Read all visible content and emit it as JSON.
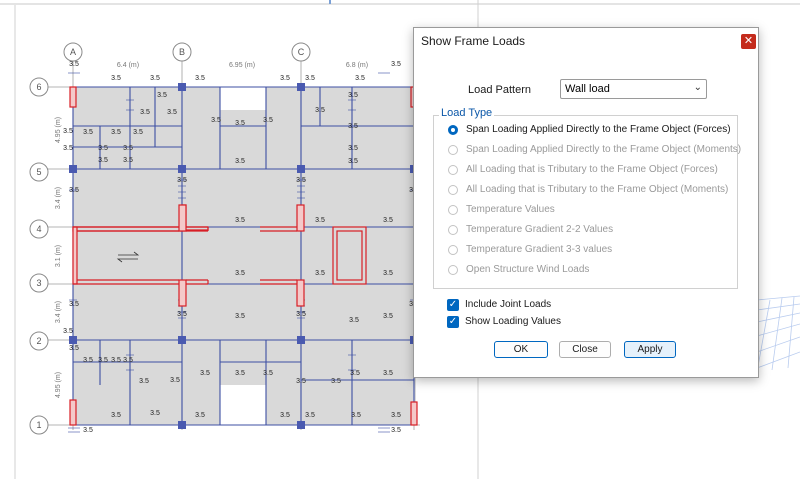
{
  "plan": {
    "grid_x_labels": [
      "A",
      "B",
      "C"
    ],
    "grid_y_labels": [
      "6",
      "5",
      "4",
      "3",
      "2",
      "1"
    ],
    "x_spacing_labels": [
      "6.4 (m)",
      "6.95 (m)",
      "6.8 (m)"
    ],
    "y_spacing_labels": [
      "4.95 (m)",
      "3.4 (m)",
      "3.1 (m)",
      "3.4 (m)",
      "4.95 (m)"
    ],
    "load_value": "3.5",
    "colors": {
      "slab": "#d9d9d9",
      "beam": "#3d4fa3",
      "wall": "#d81f26",
      "wall_fill": "#f4c9c9",
      "column": "#4a5ab0",
      "grid_line": "#9e9e9e"
    }
  },
  "dialog": {
    "title": "Show Frame Loads",
    "close_icon": "close-icon",
    "load_pattern_label": "Load Pattern",
    "load_pattern_value": "Wall load",
    "load_type_label": "Load Type",
    "load_type_options": [
      {
        "label": "Span Loading Applied Directly to the Frame Object (Forces)",
        "selected": true,
        "enabled": true
      },
      {
        "label": "Span Loading Applied Directly to the Frame Object (Moments)",
        "selected": false,
        "enabled": false
      },
      {
        "label": "All Loading that is Tributary to the Frame Object (Forces)",
        "selected": false,
        "enabled": false
      },
      {
        "label": "All Loading that is Tributary to the Frame Object (Moments)",
        "selected": false,
        "enabled": false
      },
      {
        "label": "Temperature Values",
        "selected": false,
        "enabled": false
      },
      {
        "label": "Temperature Gradient 2-2 Values",
        "selected": false,
        "enabled": false
      },
      {
        "label": "Temperature Gradient 3-3 values",
        "selected": false,
        "enabled": false
      },
      {
        "label": "Open Structure Wind Loads",
        "selected": false,
        "enabled": false
      }
    ],
    "include_joint_loads_label": "Include Joint Loads",
    "include_joint_loads_checked": true,
    "show_loading_values_label": "Show Loading Values",
    "show_loading_values_checked": true,
    "buttons": {
      "ok": "OK",
      "close": "Close",
      "apply": "Apply"
    },
    "colors": {
      "accent": "#0067c0",
      "close_red": "#c42b1c"
    }
  }
}
